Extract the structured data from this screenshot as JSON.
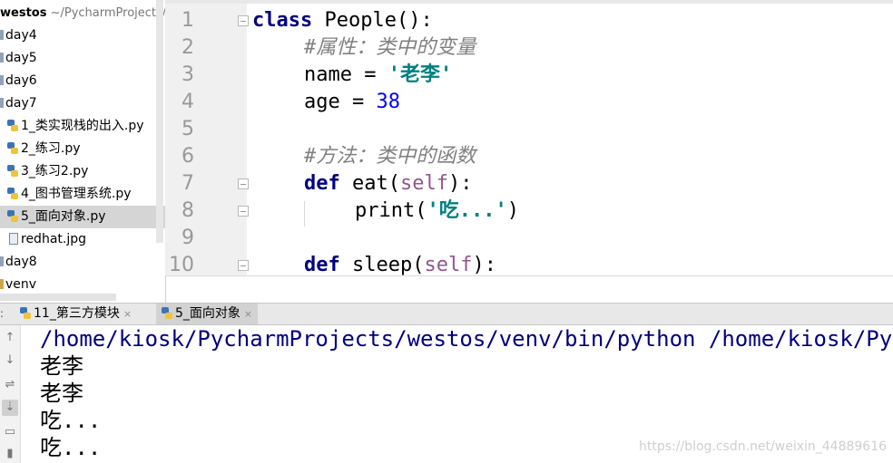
{
  "project": {
    "root_name": "westos",
    "root_path": "~/PycharmProjects/w",
    "items": [
      {
        "label": "day4",
        "kind": "folder"
      },
      {
        "label": "day5",
        "kind": "folder"
      },
      {
        "label": "day6",
        "kind": "folder"
      },
      {
        "label": "day7",
        "kind": "folder"
      },
      {
        "label": "1_类实现栈的出入.py",
        "kind": "python"
      },
      {
        "label": "2_练习.py",
        "kind": "python"
      },
      {
        "label": "3_练习2.py",
        "kind": "python"
      },
      {
        "label": "4_图书管理系统.py",
        "kind": "python"
      },
      {
        "label": "5_面向对象.py",
        "kind": "python",
        "selected": true
      },
      {
        "label": "redhat.jpg",
        "kind": "image"
      },
      {
        "label": "day8",
        "kind": "folder"
      },
      {
        "label": "venv",
        "kind": "folder"
      }
    ]
  },
  "editor": {
    "line_numbers": [
      "1",
      "2",
      "3",
      "4",
      "5",
      "6",
      "7",
      "8",
      "9",
      "10"
    ],
    "lines": [
      {
        "kw": "class",
        "text": " People():"
      },
      {
        "comment": "#属性：类中的变量"
      },
      {
        "name": "name",
        "op": " = ",
        "str": "'老李'"
      },
      {
        "name": "age",
        "op": " = ",
        "num": "38"
      },
      {},
      {
        "comment": "#方法：类中的函数"
      },
      {
        "kw": "def",
        "fn": " eat(",
        "self": "self",
        "tail": "):"
      },
      {
        "fn": "print(",
        "str": "'吃...'",
        "tail": ")"
      },
      {},
      {
        "kw": "def",
        "fn": " sleep(",
        "self": "self",
        "tail": "):"
      }
    ]
  },
  "run": {
    "tabs": [
      {
        "label": "11_第三方模块",
        "close": "×"
      },
      {
        "label": "5_面向对象",
        "close": "×",
        "active": true
      }
    ],
    "output": [
      "/home/kiosk/PycharmProjects/westos/venv/bin/python /home/kiosk/Pycha",
      "老李",
      "老李",
      "吃...",
      "吃..."
    ],
    "toolbar_icons": [
      "arrow-up-icon",
      "arrow-down-icon",
      "soft-wrap-icon",
      "scroll-to-end-icon",
      "print-icon",
      "trash-icon"
    ]
  },
  "watermark": "https://blog.csdn.net/weixin_44889616"
}
